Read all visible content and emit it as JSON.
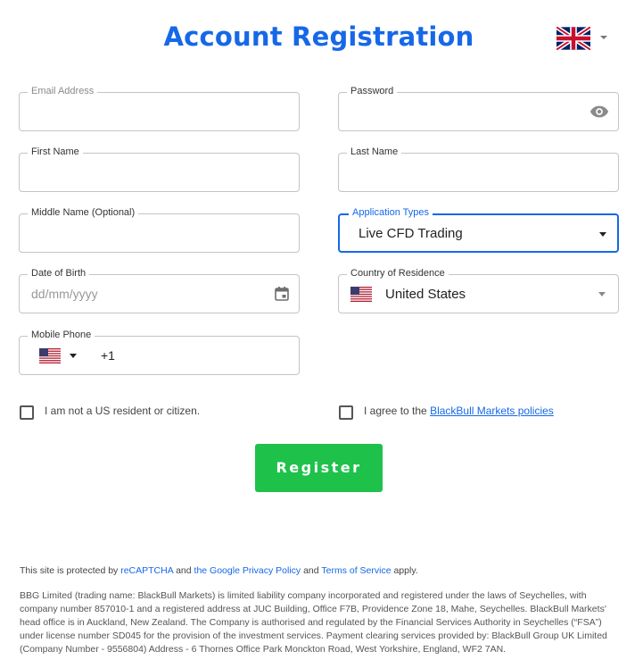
{
  "title": "Account Registration",
  "language": {
    "flag_icon": "uk-flag-icon"
  },
  "fields": {
    "email": {
      "label": "Email Address",
      "value": "",
      "placeholder": ""
    },
    "password": {
      "label": "Password",
      "value": "",
      "placeholder": ""
    },
    "first_name": {
      "label": "First Name",
      "value": "",
      "placeholder": ""
    },
    "last_name": {
      "label": "Last Name",
      "value": "",
      "placeholder": ""
    },
    "middle_name": {
      "label": "Middle Name (Optional)",
      "value": "",
      "placeholder": ""
    },
    "application_type": {
      "label": "Application Types",
      "value": "Live CFD Trading"
    },
    "dob": {
      "label": "Date of Birth",
      "value": "",
      "placeholder": "dd/mm/yyyy"
    },
    "country": {
      "label": "Country of Residence",
      "value": "United States",
      "flag_icon": "us-flag-icon"
    },
    "mobile": {
      "label": "Mobile Phone",
      "dial_code": "+1",
      "flag_icon": "us-flag-icon"
    }
  },
  "checks": {
    "us_resident": {
      "text": "I am not a US resident or citizen.",
      "checked": false
    },
    "policies": {
      "text": "I agree to the",
      "link": "BlackBull Markets policies",
      "checked": false
    }
  },
  "register_label": "Register",
  "recaptcha": {
    "prefix": "This site is protected by",
    "recaptcha_link": "reCAPTCHA",
    "and1": "and",
    "privacy_link": "the Google Privacy Policy",
    "and2": "and",
    "terms_link": "Terms of Service",
    "suffix": "apply."
  },
  "legal_text": "BBG Limited (trading name: BlackBull Markets) is limited liability company incorporated and registered under the laws of Seychelles, with company number 857010-1 and a registered address at JUC Building, Office F7B, Providence Zone 18, Mahe, Seychelles. BlackBull Markets' head office is in Auckland, New Zealand. The Company is authorised and regulated by the Financial Services Authority in Seychelles (“FSA”) under license number SD045 for the provision of the investment services. Payment clearing services provided by: BlackBull Group UK Limited (Company Number - 9556804) Address - 6 Thornes Office Park Monckton Road, West Yorkshire, England, WF2 7AN.",
  "colors": {
    "accent": "#1668e8",
    "register": "#1ec24b",
    "border": "#c4c4c4"
  }
}
